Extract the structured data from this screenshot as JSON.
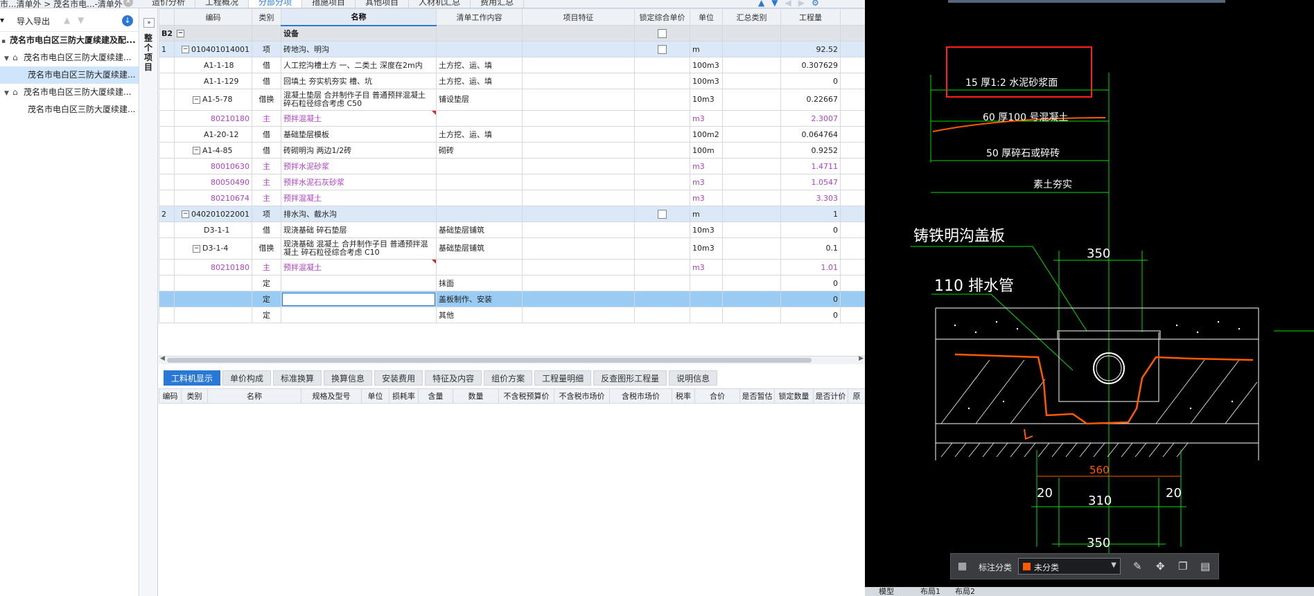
{
  "breadcrumb": "市...清单外 > 茂名市电...-清单外",
  "main_tabs": [
    "造价分析",
    "工程概况",
    "分部分项",
    "措施项目",
    "其他项目",
    "人材机汇总",
    "费用汇总"
  ],
  "left_toolbar": {
    "import_export": "导入导出"
  },
  "tree": [
    {
      "label": "茂名市电白区三防大厦续建及配...",
      "root": true
    },
    {
      "label": "茂名市电白区三防大厦续建..."
    },
    {
      "label": "茂名市电白区三防大厦续建..."
    },
    {
      "label": "茂名市电白区三防大厦续建..."
    },
    {
      "label": "茂名市电白区三防大厦续建..."
    }
  ],
  "side_strip": "整个项目",
  "grid": {
    "headers": [
      "",
      "编码",
      "类别",
      "名称",
      "清单工作内容",
      "项目特征",
      "锁定综合单价",
      "单位",
      "汇总类别",
      "工程量",
      ""
    ],
    "group_label": "B2",
    "group_name": "设备",
    "rows": [
      {
        "seq": "1",
        "code": "010401014001",
        "type": "项",
        "name": "砖地沟、明沟",
        "work": "",
        "unit": "m",
        "qty": "92.52"
      },
      {
        "code": "A1-1-18",
        "type": "借",
        "name": "人工挖沟槽土方 一、二类土 深度在2m内",
        "work": "土方挖、运、填",
        "unit": "100m3",
        "qty": "0.307629"
      },
      {
        "code": "A1-1-129",
        "type": "借",
        "name": "回填土 夯实机夯实 槽、坑",
        "work": "土方挖、运、填",
        "unit": "100m3",
        "qty": "0"
      },
      {
        "code": "A1-5-78",
        "type": "借换",
        "name": "混凝土垫层 合并制作子目 普通预拌混凝土 碎石粒径综合考虑 C50",
        "work": "铺设垫层",
        "unit": "10m3",
        "qty": "0.22667"
      },
      {
        "code": "80210180",
        "type": "主",
        "name": "预拌混凝土",
        "work": "",
        "unit": "m3",
        "qty": "2.3007"
      },
      {
        "code": "A1-20-12",
        "type": "借",
        "name": "基础垫层模板",
        "work": "土方挖、运、填",
        "unit": "100m2",
        "qty": "0.064764"
      },
      {
        "code": "A1-4-85",
        "type": "借",
        "name": "砖砌明沟 两边1/2砖",
        "work": "砌砖",
        "unit": "100m",
        "qty": "0.9252"
      },
      {
        "code": "80010630",
        "type": "主",
        "name": "预拌水泥砂浆",
        "work": "",
        "unit": "m3",
        "qty": "1.4711"
      },
      {
        "code": "80050490",
        "type": "主",
        "name": "预拌水泥石灰砂浆",
        "work": "",
        "unit": "m3",
        "qty": "1.0547"
      },
      {
        "code": "80210674",
        "type": "主",
        "name": "预拌混凝土",
        "work": "",
        "unit": "m3",
        "qty": "3.303"
      },
      {
        "seq": "2",
        "code": "040201022001",
        "type": "项",
        "name": "排水沟、截水沟",
        "work": "",
        "unit": "m",
        "qty": "1"
      },
      {
        "code": "D3-1-1",
        "type": "借",
        "name": "现浇基础 碎石垫层",
        "work": "基础垫层铺筑",
        "unit": "10m3",
        "qty": "0"
      },
      {
        "code": "D3-1-4",
        "type": "借换",
        "name": "现浇基础 混凝土 合并制作子目 普通预拌混凝土 碎石粒径综合考虑 C10",
        "work": "基础垫层铺筑",
        "unit": "10m3",
        "qty": "0.1"
      },
      {
        "code": "80210180",
        "type": "主",
        "name": "预拌混凝土",
        "work": "",
        "unit": "m3",
        "qty": "1.01"
      },
      {
        "code": "",
        "type": "定",
        "name": "",
        "work": "抹面",
        "unit": "",
        "qty": "0"
      },
      {
        "code": "",
        "type": "定",
        "name": "",
        "work": "盖板制作、安装",
        "unit": "",
        "qty": "0"
      },
      {
        "code": "",
        "type": "定",
        "name": "",
        "work": "其他",
        "unit": "",
        "qty": "0"
      }
    ]
  },
  "bottom_tabs": [
    "工料机显示",
    "单价构成",
    "标准换算",
    "换算信息",
    "安装费用",
    "特征及内容",
    "组价方案",
    "工程量明细",
    "反查图形工程量",
    "说明信息"
  ],
  "sub_headers": [
    "编码",
    "类别",
    "名称",
    "规格及型号",
    "单位",
    "损耗率",
    "含量",
    "数量",
    "不含税预算价",
    "不含税市场价",
    "含税市场价",
    "税率",
    "合价",
    "是否暂估",
    "锁定数量",
    "是否计价",
    "原"
  ],
  "cad": {
    "layers": [
      "15 厚1:2 水泥砂浆面",
      "60 厚100 号混凝土",
      "50 厚碎石或碎砖",
      "素土夯实"
    ],
    "label_cover": "铸铁明沟盖板",
    "label_pipe": "110 排水管",
    "dim_top": "350",
    "dim_560": "560",
    "dim_20_left": "20",
    "dim_310": "310",
    "dim_20_right": "20",
    "dim_bottom": "350",
    "toolbar_label": "标注分类",
    "toolbar_value": "未分类",
    "status_left": "模型",
    "status_mid1": "布局1",
    "status_mid2": "布局2"
  },
  "colors": {
    "accent": "#2a78d6",
    "selected_row": "#99cbf3",
    "main_material": "#b13fc9",
    "cad_green": "#00e000",
    "cad_orange": "#ff5a00",
    "cad_red": "#ff2020"
  }
}
